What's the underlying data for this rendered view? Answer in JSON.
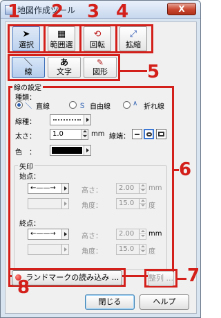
{
  "window": {
    "title": "地図作成ツール",
    "close_glyph": "X"
  },
  "toolbar": {
    "buttons": [
      {
        "label": "選択",
        "icon": "cursor-arrow-icon"
      },
      {
        "label": "範囲選",
        "icon": "range-select-icon"
      },
      {
        "label": "回転",
        "icon": "rotate-icon"
      },
      {
        "label": "拡縮",
        "icon": "scale-icon"
      }
    ]
  },
  "drawtabs": [
    {
      "label": "線",
      "icon": "line-icon",
      "glyph": "＼",
      "active": true
    },
    {
      "label": "文字",
      "icon": "text-icon",
      "glyph": "あ",
      "active": false
    },
    {
      "label": "図形",
      "icon": "shape-pen-icon",
      "glyph": "✎",
      "active": false
    }
  ],
  "line_settings": {
    "group_label": "線の設定",
    "type_label": "種類：",
    "types": [
      {
        "label": "直線",
        "glyph": "＼",
        "selected": true
      },
      {
        "label": "自由線",
        "glyph": "Ｓ",
        "selected": false
      },
      {
        "label": "折れ線",
        "glyph": "∧",
        "selected": false
      }
    ],
    "linetype_label": "線種：",
    "thickness_label": "太さ：",
    "thickness_value": "1.0",
    "thickness_unit": "mm",
    "endcap_label": "線端：",
    "color_label": "色　："
  },
  "arrow": {
    "group_label": "矢印",
    "start_label": "始点：",
    "end_label": "終点：",
    "height_label": "高さ：",
    "angle_label": "角度：",
    "start_height": "2.00",
    "start_angle": "15.0",
    "end_height": "2.00",
    "end_angle": "15.0",
    "unit_mm": "mm",
    "unit_deg": "度"
  },
  "buttons": {
    "landmark": "ランドマークの読み込み ...",
    "align": "整列 ...",
    "close": "閉じる",
    "help": "ヘルプ"
  },
  "callouts": [
    "1",
    "2",
    "3",
    "4",
    "5",
    "6",
    "7",
    "8"
  ],
  "colors": {
    "callout": "#d4201a",
    "selected_accent": "#3b78d6"
  }
}
